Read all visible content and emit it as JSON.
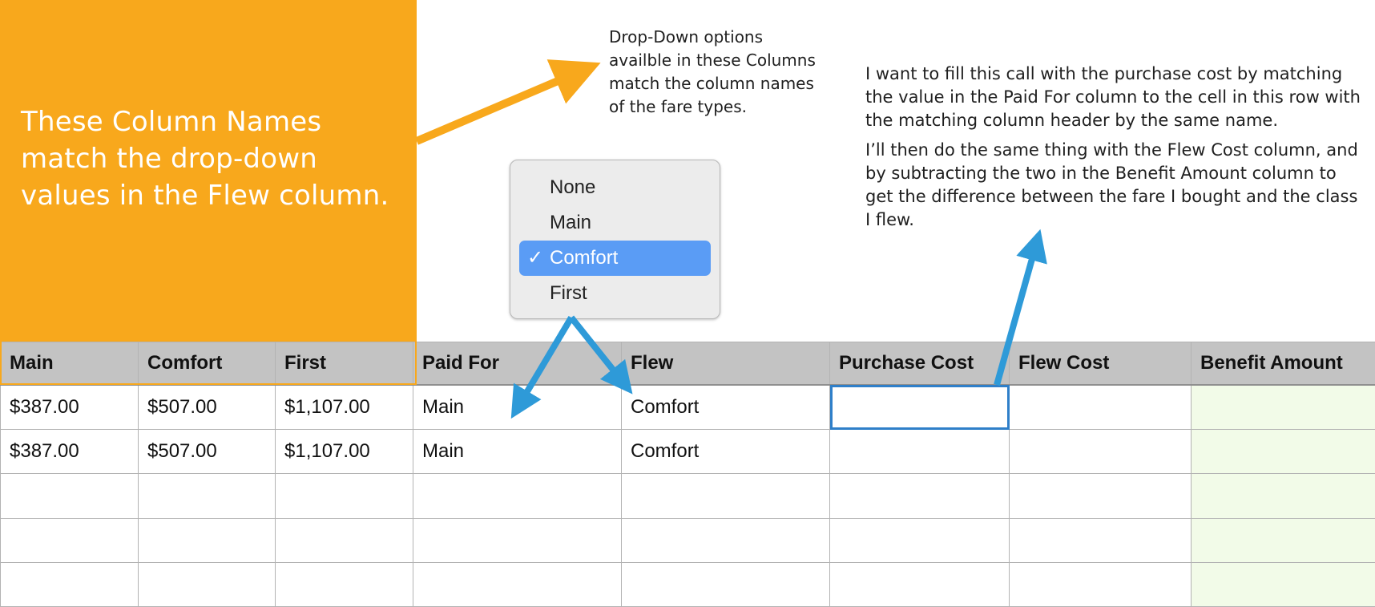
{
  "callout": {
    "text": "These Column Names match the drop-down values in the Flew column."
  },
  "notes": {
    "dropdown_note": "Drop-Down options availble in these Columns match the column names of the fare types.",
    "request_p1": "I want to fill this call with the purchase cost by matching the value in the Paid For column to the cell in this row with the matching column header by the same name.",
    "request_p2": "I’ll then do the same thing with the Flew Cost column, and by subtracting the two in the Benefit Amount column to get the difference between the fare I bought and the class I flew."
  },
  "dropdown": {
    "options": [
      "None",
      "Main",
      "Comfort",
      "First"
    ],
    "selected": "Comfort",
    "check_glyph": "✓"
  },
  "table": {
    "headers": [
      "Main",
      "Comfort",
      "First",
      "Paid For",
      "Flew",
      "Purchase Cost",
      "Flew Cost",
      "Benefit Amount"
    ],
    "rows": [
      [
        "$387.00",
        "$507.00",
        "$1,107.00",
        "Main",
        "Comfort",
        "",
        "",
        ""
      ],
      [
        "$387.00",
        "$507.00",
        "$1,107.00",
        "Main",
        "Comfort",
        "",
        "",
        ""
      ],
      [
        "",
        "",
        "",
        "",
        "",
        "",
        "",
        ""
      ],
      [
        "",
        "",
        "",
        "",
        "",
        "",
        "",
        ""
      ],
      [
        "",
        "",
        "",
        "",
        "",
        "",
        "",
        ""
      ]
    ]
  },
  "colors": {
    "callout_orange": "#F8A81C",
    "arrow_blue": "#2E9AD8",
    "selection_blue": "#5A9CF5",
    "header_gray": "#C3C3C3",
    "benefit_green": "#F2FBE8"
  }
}
